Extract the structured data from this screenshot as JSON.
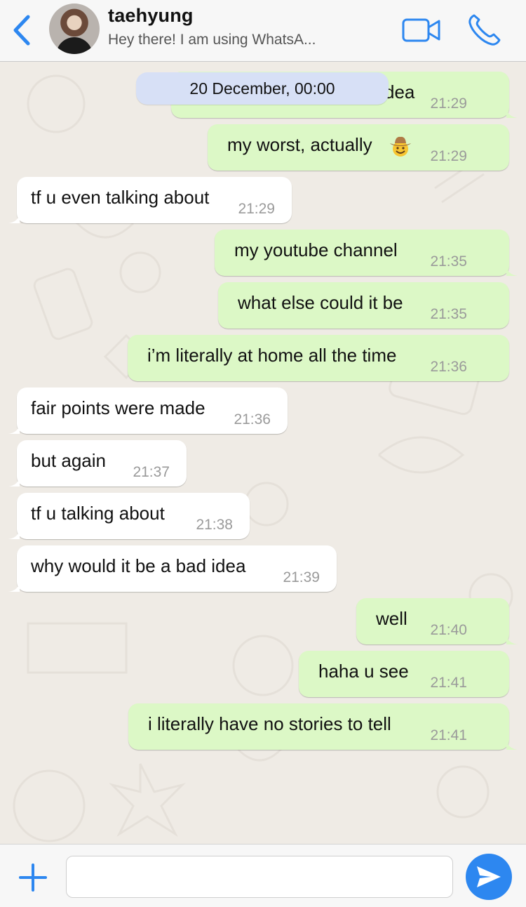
{
  "header": {
    "contact_name": "taehyung",
    "status": "Hey there! I am using WhatsA...",
    "icons": {
      "back": "chevron-left-icon",
      "video": "video-camera-icon",
      "call": "phone-icon"
    },
    "accent_color": "#2d87f0"
  },
  "chat": {
    "date_label": "20 December, 00:00",
    "messages": [
      {
        "direction": "out",
        "text": "dea",
        "time": "21:29"
      },
      {
        "direction": "out",
        "text": "my worst, actually",
        "emoji": "cowboy-hat-face-icon",
        "time": "21:29"
      },
      {
        "direction": "in",
        "text": "tf u even talking about",
        "time": "21:29"
      },
      {
        "direction": "out",
        "text": "my youtube channel",
        "time": "21:35"
      },
      {
        "direction": "out",
        "text": "what else could it be",
        "time": "21:35"
      },
      {
        "direction": "out",
        "text": "i’m literally at home all the time",
        "time": "21:36"
      },
      {
        "direction": "in",
        "text": "fair points were made",
        "time": "21:36"
      },
      {
        "direction": "in",
        "text": "but again",
        "time": "21:37"
      },
      {
        "direction": "in",
        "text": "tf u talking about",
        "time": "21:38"
      },
      {
        "direction": "in",
        "text": "why would it be a bad idea",
        "time": "21:39"
      },
      {
        "direction": "out",
        "text": "well",
        "time": "21:40"
      },
      {
        "direction": "out",
        "text": "haha u see",
        "time": "21:41"
      },
      {
        "direction": "out",
        "text": "i literally have no stories to tell",
        "time": "21:41"
      }
    ],
    "colors": {
      "outgoing": "#dcf8c6",
      "incoming": "#ffffff",
      "date_pill": "#d7e0f6"
    }
  },
  "composer": {
    "input_value": "",
    "icons": {
      "attach": "plus-icon",
      "send": "send-arrow-icon"
    }
  }
}
